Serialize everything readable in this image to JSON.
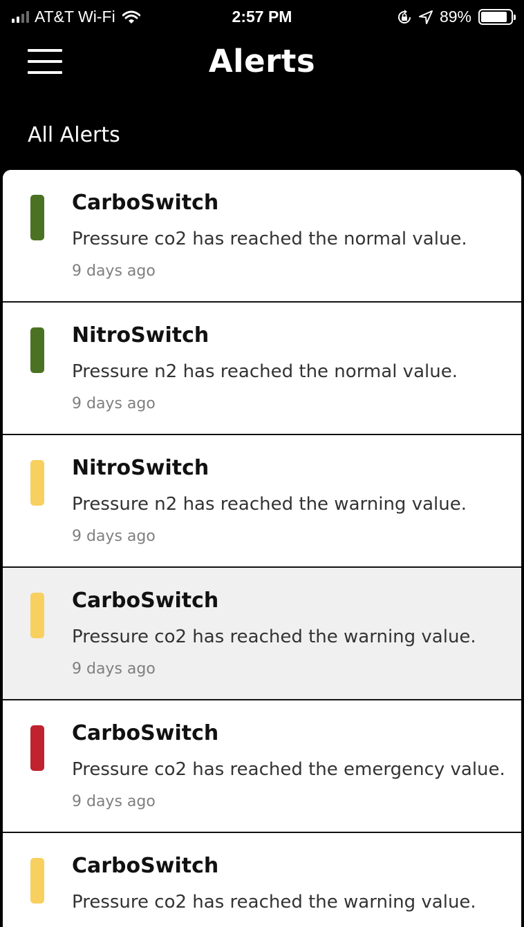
{
  "status_bar": {
    "carrier": "AT&T Wi-Fi",
    "time": "2:57 PM",
    "battery_percent": "89%",
    "battery_level": 0.89,
    "icons": [
      "signal-icon",
      "wifi-icon",
      "orientation-lock-icon",
      "location-arrow-icon",
      "battery-icon"
    ]
  },
  "nav": {
    "title": "Alerts",
    "menu_icon": "hamburger-menu-icon"
  },
  "section_title": "All Alerts",
  "colors": {
    "normal": "#4a7222",
    "warning": "#f7d05f",
    "emergency": "#c0222f",
    "highlight_bg": "#eff0ef"
  },
  "alerts": [
    {
      "source": "CarboSwitch",
      "message": "Pressure co2 has reached the normal value.",
      "time": "9 days ago",
      "severity": "normal",
      "highlighted": false
    },
    {
      "source": "NitroSwitch",
      "message": "Pressure n2 has reached the normal value.",
      "time": "9 days ago",
      "severity": "normal",
      "highlighted": false
    },
    {
      "source": "NitroSwitch",
      "message": "Pressure n2 has reached the warning value.",
      "time": "9 days ago",
      "severity": "warning",
      "highlighted": false
    },
    {
      "source": "CarboSwitch",
      "message": "Pressure co2 has reached the warning value.",
      "time": "9 days ago",
      "severity": "warning",
      "highlighted": true
    },
    {
      "source": "CarboSwitch",
      "message": "Pressure co2 has reached the emergency value.",
      "time": "9 days ago",
      "severity": "emergency",
      "highlighted": false
    },
    {
      "source": "CarboSwitch",
      "message": "Pressure co2 has reached the warning value.",
      "time": "9 days ago",
      "severity": "warning",
      "highlighted": false
    }
  ]
}
